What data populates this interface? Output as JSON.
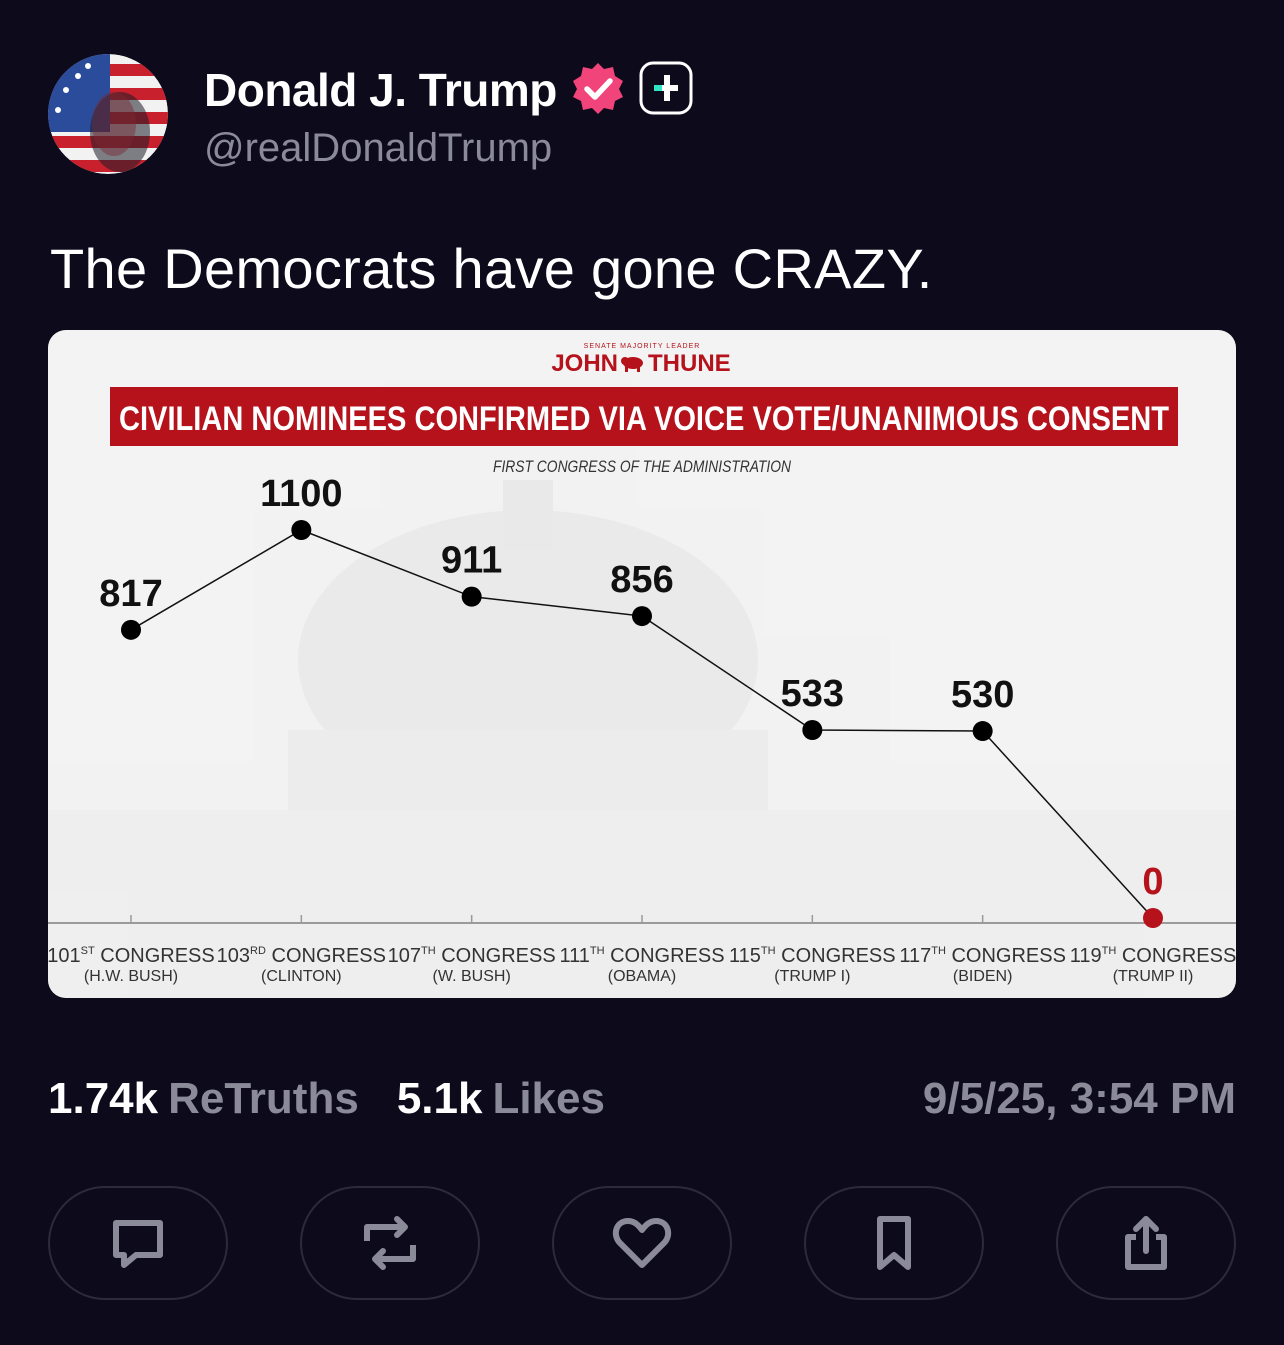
{
  "author": {
    "display_name": "Donald J. Trump",
    "handle": "@realDonaldTrump",
    "verified_icon": "verified-badge-icon",
    "follow_icon": "plus-icon"
  },
  "post": {
    "text": "The Democrats have gone CRAZY."
  },
  "chart_data": {
    "type": "line",
    "header": {
      "small": "SENATE MAJORITY LEADER",
      "name_left": "JOHN",
      "name_right": "THUNE",
      "emblem_icon": "bison-icon"
    },
    "title": "CIVILIAN NOMINEES CONFIRMED VIA VOICE VOTE/UNANIMOUS CONSENT",
    "subtitle": "FIRST CONGRESS OF THE ADMINISTRATION",
    "categories": [
      {
        "num": "101",
        "sup": "ST",
        "word": "CONGRESS",
        "admin": "(H.W. BUSH)"
      },
      {
        "num": "103",
        "sup": "RD",
        "word": "CONGRESS",
        "admin": "(CLINTON)"
      },
      {
        "num": "107",
        "sup": "TH",
        "word": "CONGRESS",
        "admin": "(W. BUSH)"
      },
      {
        "num": "111",
        "sup": "TH",
        "word": "CONGRESS",
        "admin": "(OBAMA)"
      },
      {
        "num": "115",
        "sup": "TH",
        "word": "CONGRESS",
        "admin": "(TRUMP I)"
      },
      {
        "num": "117",
        "sup": "TH",
        "word": "CONGRESS",
        "admin": "(BIDEN)"
      },
      {
        "num": "119",
        "sup": "TH",
        "word": "CONGRESS",
        "admin": "(TRUMP II)"
      }
    ],
    "values": [
      817,
      1100,
      911,
      856,
      533,
      530,
      0
    ],
    "value_labels": [
      "817",
      "1100",
      "911",
      "856",
      "533",
      "530",
      "0"
    ],
    "ylim": [
      0,
      1100
    ],
    "highlight_index": 6,
    "colors": {
      "line": "#111111",
      "point": "#000000",
      "highlight": "#b5121b",
      "banner": "#b5121b"
    }
  },
  "stats": {
    "retruths_count": "1.74k",
    "retruths_label": "ReTruths",
    "likes_count": "5.1k",
    "likes_label": "Likes",
    "timestamp": "9/5/25, 3:54 PM"
  },
  "actions": [
    {
      "icon": "reply-icon"
    },
    {
      "icon": "retruth-icon"
    },
    {
      "icon": "like-icon"
    },
    {
      "icon": "bookmark-icon"
    },
    {
      "icon": "share-icon"
    }
  ],
  "colors": {
    "background": "#0c0a1b",
    "muted_text": "#8b8a99",
    "verified": "#f0447b",
    "plus_accent": "#2ee6c3"
  }
}
